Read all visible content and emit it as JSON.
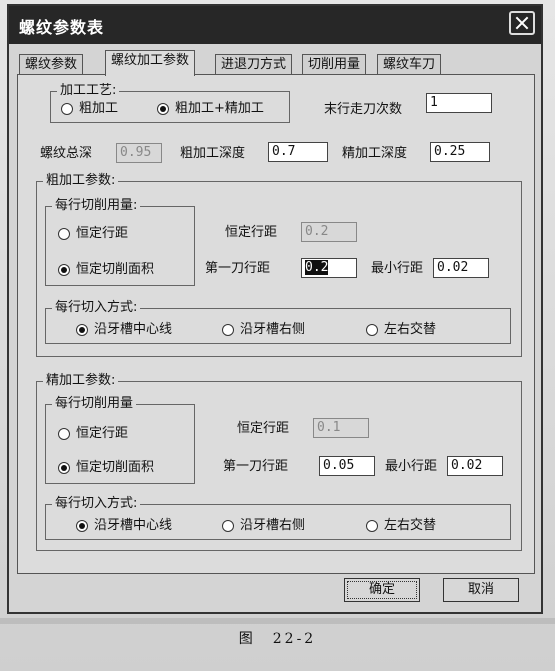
{
  "window": {
    "title": "螺纹参数表"
  },
  "tabs": [
    {
      "label": "螺纹参数"
    },
    {
      "label": "螺纹加工参数"
    },
    {
      "label": "进退刀方式"
    },
    {
      "label": "切削用量"
    },
    {
      "label": "螺纹车刀"
    }
  ],
  "process": {
    "legend": "加工工艺:",
    "options": [
      {
        "label": "粗加工",
        "selected": false
      },
      {
        "label": "粗加工+精加工",
        "selected": true
      }
    ]
  },
  "last_pass": {
    "label": "末行走刀次数",
    "value": "1"
  },
  "depth": {
    "total_label": "螺纹总深",
    "total_value": "0.95",
    "rough_label": "粗加工深度",
    "rough_value": "0.7",
    "finish_label": "精加工深度",
    "finish_value": "0.25"
  },
  "rough": {
    "legend": "粗加工参数:",
    "cut_legend": "每行切削用量:",
    "cut_options": [
      {
        "label": "恒定行距",
        "selected": false
      },
      {
        "label": "恒定切削面积",
        "selected": true
      }
    ],
    "const_label": "恒定行距",
    "const_value": "0.2",
    "first_label": "第一刀行距",
    "first_value": "0.2",
    "min_label": "最小行距",
    "min_value": "0.02",
    "infeed_legend": "每行切入方式:",
    "infeed_options": [
      {
        "label": "沿牙槽中心线",
        "selected": true
      },
      {
        "label": "沿牙槽右侧",
        "selected": false
      },
      {
        "label": "左右交替",
        "selected": false
      }
    ]
  },
  "finish": {
    "legend": "精加工参数:",
    "cut_legend": "每行切削用量",
    "cut_options": [
      {
        "label": "恒定行距",
        "selected": false
      },
      {
        "label": "恒定切削面积",
        "selected": true
      }
    ],
    "const_label": "恒定行距",
    "const_value": "0.1",
    "first_label": "第一刀行距",
    "first_value": "0.05",
    "min_label": "最小行距",
    "min_value": "0.02",
    "infeed_legend": "每行切入方式:",
    "infeed_options": [
      {
        "label": "沿牙槽中心线",
        "selected": true
      },
      {
        "label": "沿牙槽右侧",
        "selected": false
      },
      {
        "label": "左右交替",
        "selected": false
      }
    ]
  },
  "buttons": {
    "ok": "确定",
    "cancel": "取消"
  },
  "caption": "图　22-2"
}
